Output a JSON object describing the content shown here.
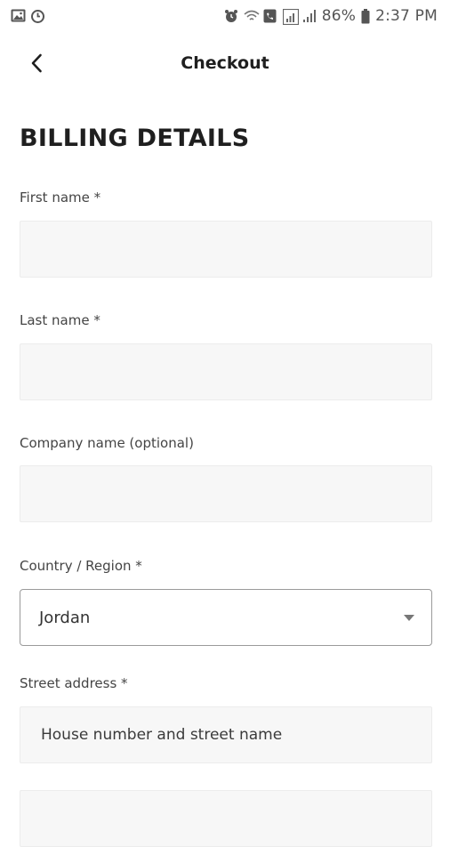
{
  "status_bar": {
    "battery": "86%",
    "time": "2:37 PM",
    "icons": [
      "gallery-icon",
      "sync-icon",
      "alarm-icon",
      "wifi-calling-icon",
      "signal-icon",
      "signal-bars-icon",
      "battery-icon"
    ]
  },
  "header": {
    "back_icon": "chevron-left-icon",
    "title": "Checkout"
  },
  "form": {
    "section_title": "BILLING DETAILS",
    "first_name": {
      "label": "First name *",
      "value": ""
    },
    "last_name": {
      "label": "Last name *",
      "value": ""
    },
    "company_name": {
      "label": "Company name (optional)",
      "value": ""
    },
    "country": {
      "label": "Country / Region *",
      "selected": "Jordan"
    },
    "street_address": {
      "label": "Street address *",
      "placeholder": "House number and street name"
    }
  }
}
